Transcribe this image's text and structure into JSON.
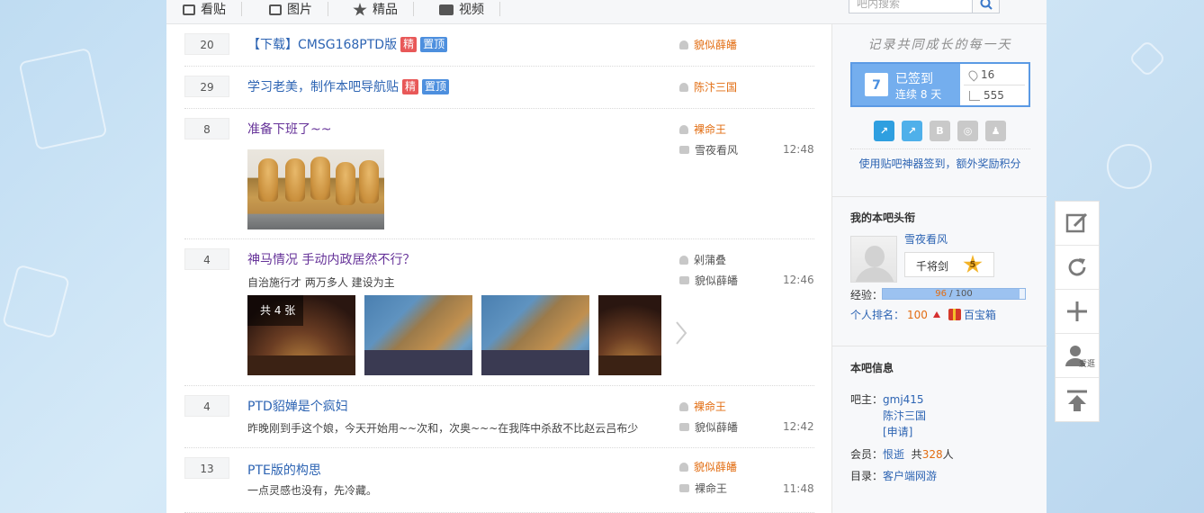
{
  "nav": {
    "tabs": [
      {
        "label": "看贴",
        "icon": "list-icon"
      },
      {
        "label": "图片",
        "icon": "image-icon"
      },
      {
        "label": "精品",
        "icon": "star-icon"
      },
      {
        "label": "视频",
        "icon": "video-icon"
      }
    ],
    "search_placeholder": "吧内搜索"
  },
  "threads": [
    {
      "count": "20",
      "title": "【下载】CMSG168PTD版",
      "tags": [
        "精",
        "置顶"
      ],
      "author": "貌似薛皤"
    },
    {
      "count": "29",
      "title": "学习老美，制作本吧导航贴",
      "tags": [
        "精",
        "置顶"
      ],
      "author": "陈汴三国"
    },
    {
      "count": "8",
      "title": "准备下班了~~",
      "author": "裸命王",
      "last_reply": "雪夜看风",
      "time": "12:48"
    },
    {
      "count": "4",
      "title": "神马情况 手动内政居然不行？",
      "abstract": "自治施行才 两万多人 建设为主",
      "author": "剁蒲叠",
      "last_reply": "貌似薛皤",
      "time": "12:46",
      "album_count": "共 4 张"
    },
    {
      "count": "4",
      "title": "PTD貂婵是个疯妇",
      "abstract": "昨晚刚到手这个娘，今天开始用~~次和，次奥~~~在我阵中杀敌不比赵云吕布少",
      "author": "裸命王",
      "last_reply": "貌似薛皤",
      "time": "12:42"
    },
    {
      "count": "13",
      "title": "PTE版的构思",
      "abstract": "一点灵感也没有，先冷藏。",
      "author": "貌似薛皤",
      "last_reply": "裸命王",
      "time": "11:48"
    }
  ],
  "sidebar": {
    "slogan": "记录共同成长的每一天",
    "sign": {
      "day": "7",
      "status": "已签到",
      "streak": "连续 8 天",
      "rank": "16",
      "total": "555"
    },
    "tool_tip": "使用贴吧神器签到，额外奖励积分",
    "my_title": {
      "heading": "我的本吧头衔",
      "username": "雪夜看风",
      "rank_name": "千将剑",
      "level": "5",
      "exp_label": "经验：",
      "exp_current": "96",
      "exp_total": " / 100",
      "exp_progress": 0.96,
      "personal_rank_label": "个人排名：",
      "personal_rank": "100",
      "treasure": "百宝箱"
    },
    "bar_info": {
      "heading": "本吧信息",
      "owner_label": "吧主：",
      "owners": [
        "gmj415",
        "陈汴三国",
        "[申请]"
      ],
      "members_label": "会员：",
      "member_name": "恨逝",
      "member_prefix": "共",
      "member_count": "328",
      "member_suffix": "人",
      "dir_label": "目录：",
      "dir_value": "客户端网游"
    }
  },
  "floating": {
    "buttons": [
      "edit-icon",
      "refresh-icon",
      "plus-icon",
      "user-icon",
      "top-icon"
    ],
    "user_text": "爱逛"
  },
  "colors": {
    "link": "#2d64b3",
    "orange": "#e26d12",
    "tag_jing": "#e85858",
    "tag_top": "#4d8fde",
    "sign_blue": "#74aeee"
  }
}
